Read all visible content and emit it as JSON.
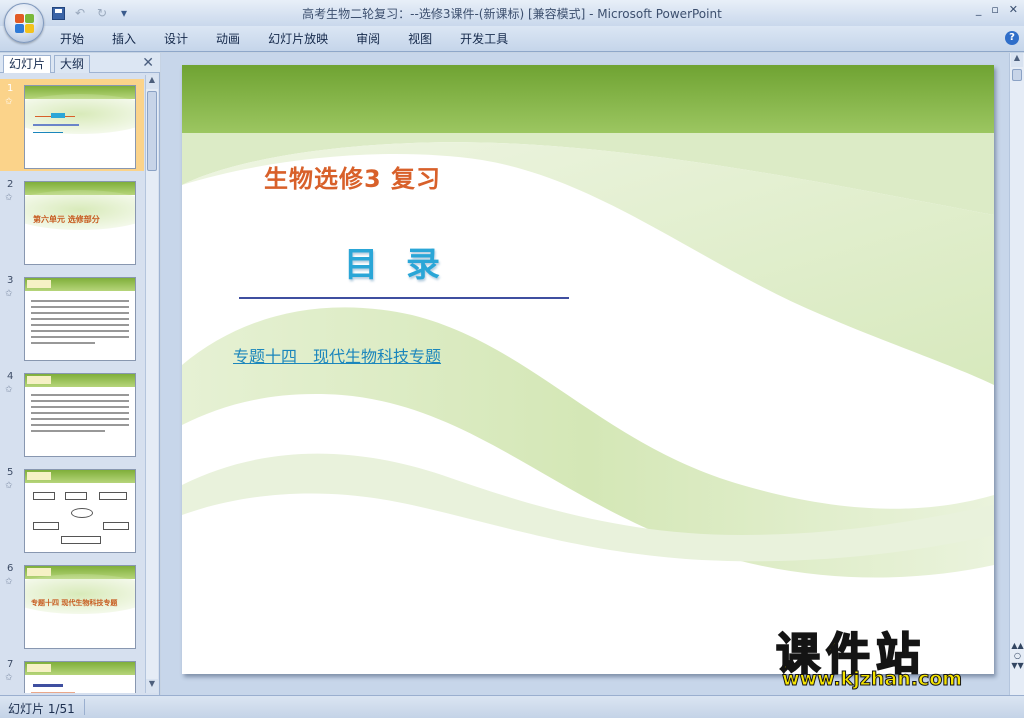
{
  "window": {
    "title": "高考生物二轮复习：--选修3课件-(新课标) [兼容模式] - Microsoft PowerPoint",
    "controls": [
      "_",
      "▫",
      "✕"
    ]
  },
  "quick_access": {
    "save": "save-icon",
    "undo": "↶",
    "redo": "↻",
    "customize": "▾"
  },
  "ribbon": {
    "tabs": [
      "开始",
      "插入",
      "设计",
      "动画",
      "幻灯片放映",
      "审阅",
      "视图",
      "开发工具"
    ],
    "help": "?"
  },
  "left_pane": {
    "tabs": {
      "slides": "幻灯片",
      "outline": "大纲"
    },
    "close": "✕",
    "thumbnails": [
      {
        "num": "1",
        "star": "✩"
      },
      {
        "num": "2",
        "star": "✩",
        "title": "第六单元 选修部分"
      },
      {
        "num": "3",
        "star": "✩"
      },
      {
        "num": "4",
        "star": "✩"
      },
      {
        "num": "5",
        "star": "✩"
      },
      {
        "num": "6",
        "star": "✩",
        "title": "专题十四 现代生物科技专题"
      },
      {
        "num": "7",
        "star": "✩"
      }
    ]
  },
  "slide": {
    "title": "生物选修3 复习",
    "heading": "目录",
    "link": "专题十四　现代生物科技专题"
  },
  "watermark": {
    "title": "课件站",
    "url": "www.kjzhan.com"
  },
  "status": {
    "slide_counter": "幻灯片 1/51"
  },
  "colors": {
    "title_orange": "#d8602a",
    "heading_blue": "#2aa6d7",
    "band_green": "#7faf3a",
    "link_blue": "#1b86bc"
  }
}
